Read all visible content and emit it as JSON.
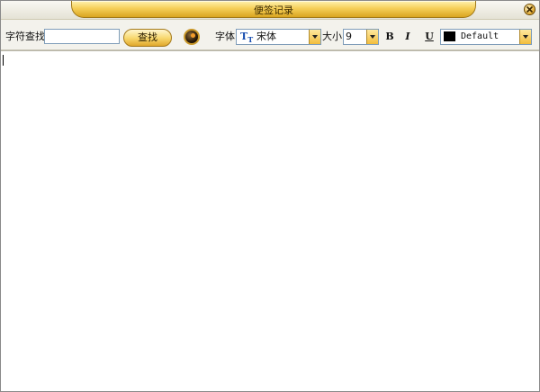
{
  "window": {
    "title": "便签记录"
  },
  "toolbar": {
    "search_label": "字符查找",
    "search_value": "",
    "find_button": "查找",
    "font_label": "字体",
    "font_value": "宋体",
    "size_label": "大小",
    "size_value": "9",
    "bold": "B",
    "italic": "I",
    "underline": "U",
    "color_value": "Default",
    "color_swatch": "#000000"
  },
  "editor": {
    "content": ""
  },
  "icons": {
    "close": "close-icon",
    "color_picker": "color-orb-icon",
    "font_type": "truetype-font-icon"
  },
  "colors": {
    "accent": "#f6d05a",
    "title_text": "#3b2a00"
  }
}
